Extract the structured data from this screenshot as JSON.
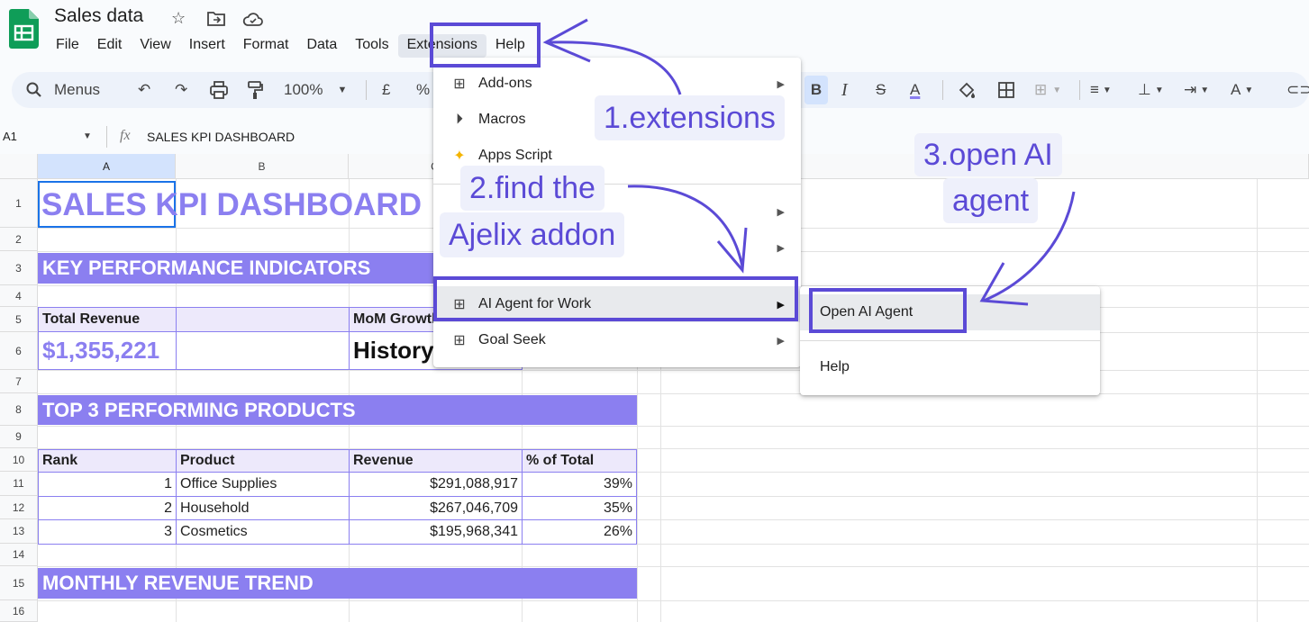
{
  "app": {
    "title": "Sales data"
  },
  "menubar": [
    "File",
    "Edit",
    "View",
    "Insert",
    "Format",
    "Data",
    "Tools",
    "Extensions",
    "Help"
  ],
  "toolbar": {
    "search_label": "Menus",
    "zoom": "100%",
    "currency": "£",
    "percent": "%"
  },
  "formula_bar": {
    "cell_ref": "A1",
    "fx": "fx",
    "content": "SALES KPI DASHBOARD"
  },
  "columns": [
    "A",
    "B",
    "C"
  ],
  "rows": [
    "1",
    "2",
    "3",
    "4",
    "5",
    "6",
    "7",
    "8",
    "9",
    "10",
    "11",
    "12",
    "13",
    "14",
    "15",
    "16"
  ],
  "sheet": {
    "title": "SALES KPI DASHBOARD",
    "kpi_header": "KEY PERFORMANCE INDICATORS",
    "total_revenue_label": "Total Revenue",
    "mom_label": "MoM Growth",
    "total_revenue_value": "$1,355,221",
    "mom_value": "History",
    "top_header": "TOP 3 PERFORMING PRODUCTS",
    "table_headers": [
      "Rank",
      "Product",
      "Revenue",
      "% of Total"
    ],
    "table_rows": [
      [
        "1",
        "Office Supplies",
        "$291,088,917",
        "39%"
      ],
      [
        "2",
        "Household",
        "$267,046,709",
        "35%"
      ],
      [
        "3",
        "Cosmetics",
        "$195,968,341",
        "26%"
      ]
    ],
    "trend_header": "MONTHLY REVENUE TREND"
  },
  "extensions_menu": [
    {
      "label": "Add-ons",
      "icon": "addon-icon",
      "submenu": true
    },
    {
      "label": "Macros",
      "icon": "play-circle-icon",
      "submenu": false
    },
    {
      "label": "Apps Script",
      "icon": "apps-script-icon",
      "submenu": false
    },
    {
      "label": "",
      "icon": "",
      "submenu": true
    },
    {
      "label": "",
      "icon": "",
      "submenu": true
    },
    {
      "label": "AI Agent for Work",
      "icon": "addon-icon",
      "submenu": true
    },
    {
      "label": "Goal Seek",
      "icon": "addon-icon",
      "submenu": true
    }
  ],
  "submenu": {
    "open": "Open AI Agent",
    "help": "Help"
  },
  "annotations": {
    "step1": "1.extensions",
    "step2_line1": "2.find the",
    "step2_line2": "Ajelix addon",
    "step3_line1": "3.open AI",
    "step3_line2": "agent"
  },
  "colors": {
    "accent": "#8b7ff0",
    "annotation": "#5b4ad6",
    "sheets_green": "#0f9d58"
  }
}
